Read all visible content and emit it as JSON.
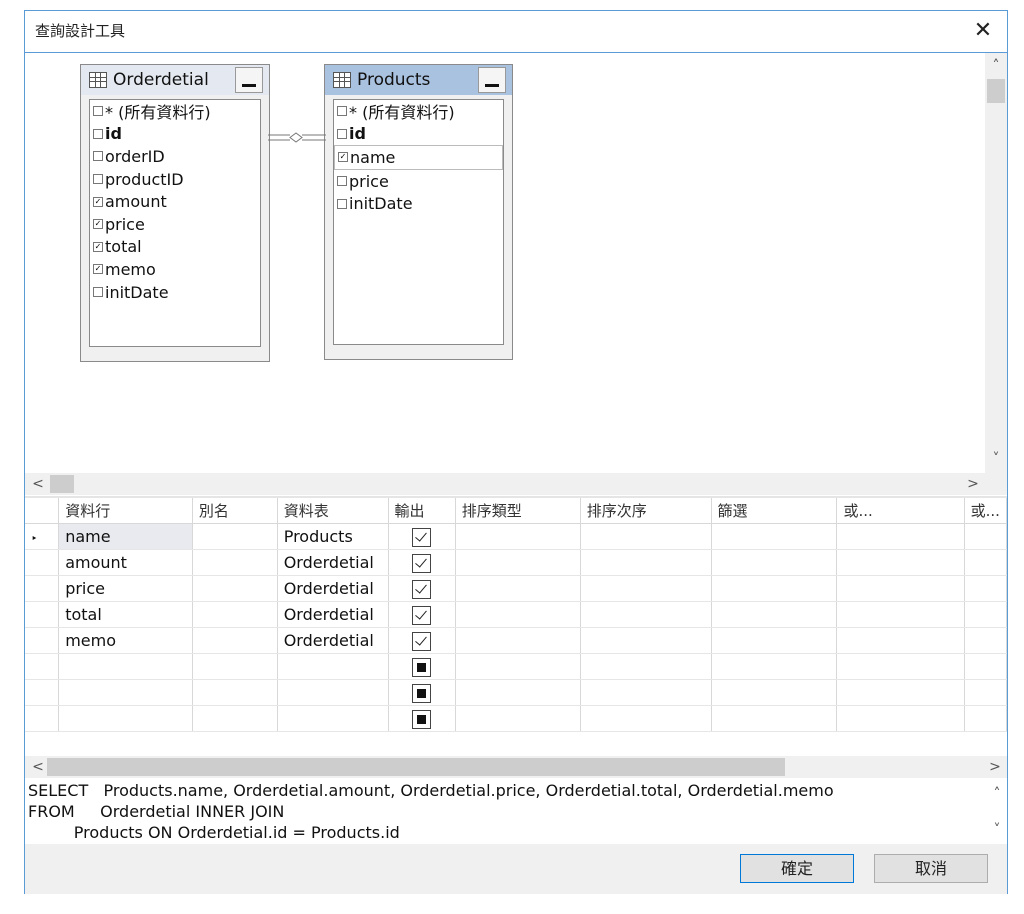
{
  "window": {
    "title": "查詢設計工具",
    "close_glyph": "✕"
  },
  "diagram": {
    "tables": [
      {
        "name": "Orderdetial",
        "columns": [
          {
            "label": "* (所有資料行)",
            "checked": false,
            "bold": false
          },
          {
            "label": "id",
            "checked": false,
            "bold": true
          },
          {
            "label": "orderID",
            "checked": false,
            "bold": false
          },
          {
            "label": "productID",
            "checked": false,
            "bold": false
          },
          {
            "label": "amount",
            "checked": true,
            "bold": false
          },
          {
            "label": "price",
            "checked": true,
            "bold": false
          },
          {
            "label": "total",
            "checked": true,
            "bold": false
          },
          {
            "label": "memo",
            "checked": true,
            "bold": false
          },
          {
            "label": "initDate",
            "checked": false,
            "bold": false
          }
        ]
      },
      {
        "name": "Products",
        "columns": [
          {
            "label": "* (所有資料行)",
            "checked": false,
            "bold": false
          },
          {
            "label": "id",
            "checked": false,
            "bold": true
          },
          {
            "label": "name",
            "checked": true,
            "bold": false
          },
          {
            "label": "price",
            "checked": false,
            "bold": false
          },
          {
            "label": "initDate",
            "checked": false,
            "bold": false
          }
        ]
      }
    ],
    "scroll": {
      "up": "˄",
      "down": "˅",
      "left": "<",
      "right": ">"
    }
  },
  "grid": {
    "headers": [
      "資料行",
      "別名",
      "資料表",
      "輸出",
      "排序類型",
      "排序次序",
      "篩選",
      "或...",
      "或..."
    ],
    "rows": [
      {
        "column": "name",
        "alias": "",
        "table": "Products",
        "output": "checked"
      },
      {
        "column": "amount",
        "alias": "",
        "table": "Orderdetial",
        "output": "checked"
      },
      {
        "column": "price",
        "alias": "",
        "table": "Orderdetial",
        "output": "checked"
      },
      {
        "column": "total",
        "alias": "",
        "table": "Orderdetial",
        "output": "checked"
      },
      {
        "column": "memo",
        "alias": "",
        "table": "Orderdetial",
        "output": "checked"
      },
      {
        "column": "",
        "alias": "",
        "table": "",
        "output": "indeterminate"
      },
      {
        "column": "",
        "alias": "",
        "table": "",
        "output": "indeterminate"
      },
      {
        "column": "",
        "alias": "",
        "table": "",
        "output": "indeterminate"
      }
    ],
    "row_indicator": "‣"
  },
  "sql": {
    "lines": [
      "SELECT   Products.name, Orderdetial.amount, Orderdetial.price, Orderdetial.total, Orderdetial.memo",
      "FROM     Orderdetial INNER JOIN",
      "         Products ON Orderdetial.id = Products.id"
    ]
  },
  "buttons": {
    "ok": "確定",
    "cancel": "取消"
  }
}
